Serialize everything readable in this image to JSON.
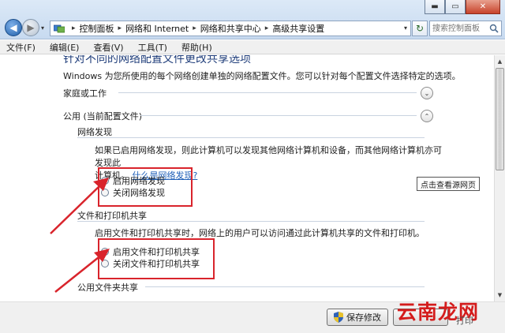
{
  "window": {
    "minimize_glyph": "▬",
    "maximize_glyph": "▭",
    "close_glyph": "✕"
  },
  "nav": {
    "back_glyph": "◀",
    "forward_glyph": "▶",
    "dropdown_glyph": "▾",
    "refresh_glyph": "↻"
  },
  "address": {
    "separator": "▸",
    "crumbs": [
      "控制面板",
      "网络和 Internet",
      "网络和共享中心",
      "高级共享设置"
    ],
    "dropdown_glyph": "▾"
  },
  "search": {
    "placeholder": "搜索控制面板"
  },
  "menu": {
    "items": [
      "文件(F)",
      "编辑(E)",
      "查看(V)",
      "工具(T)",
      "帮助(H)"
    ]
  },
  "content": {
    "heading": "针对不同的网络配置文件更改共享选项",
    "description": "Windows 为您所使用的每个网络创建单独的网络配置文件。您可以针对每个配置文件选择特定的选项。",
    "home_work_label": "家庭或工作",
    "public_label": "公用 (当前配置文件)",
    "network_discovery": {
      "title": "网络发现",
      "para_line1": "如果已启用网络发现，则此计算机可以发现其他网络计算机和设备，而其他网络计算机亦可发现此",
      "para_line2": "计算机。",
      "link": "什么是网络发现?",
      "option_on": "启用网络发现",
      "option_off": "关闭网络发现"
    },
    "file_printer_sharing": {
      "title": "文件和打印机共享",
      "para": "启用文件和打印机共享时，网络上的用户可以访问通过此计算机共享的文件和打印机。",
      "option_on": "启用文件和打印机共享",
      "option_off": "关闭文件和打印机共享"
    },
    "public_folder_label": "公用文件夹共享",
    "tooltip": "点击查看源网页",
    "chevron_down": "⌄",
    "chevron_up": "⌃"
  },
  "scrollbar": {
    "up_glyph": "▲",
    "down_glyph": "▼"
  },
  "footer": {
    "save_label": "保存修改"
  },
  "watermark": {
    "text": "云南龙网",
    "sub": "打印"
  },
  "colors": {
    "annotation_red": "#d9242c",
    "link_blue": "#1f5fb8",
    "heading_blue": "#1f3d7a"
  }
}
